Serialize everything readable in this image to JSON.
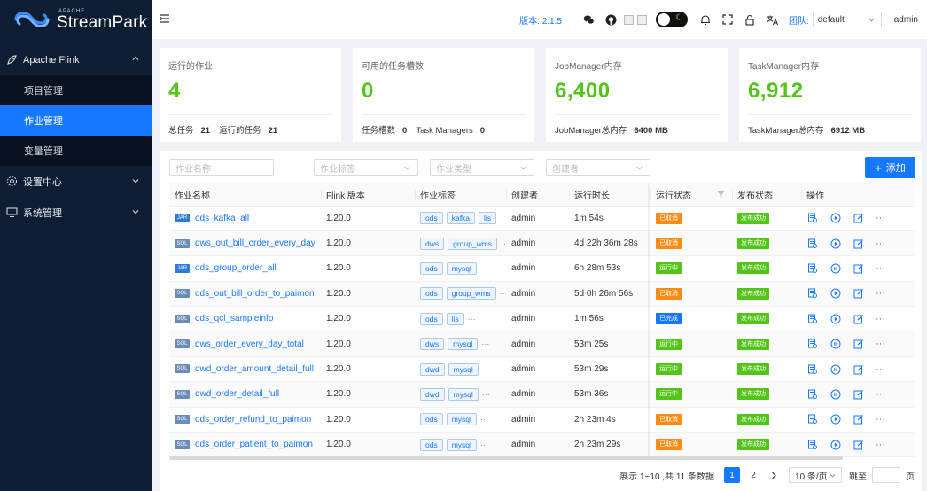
{
  "brand": {
    "apache": "APACHE",
    "name": "StreamPark"
  },
  "sidebar": {
    "groups": [
      {
        "label": "Apache Flink",
        "icon": "flink-icon",
        "expanded": true,
        "items": [
          {
            "label": "项目管理"
          },
          {
            "label": "作业管理",
            "active": true
          },
          {
            "label": "变量管理"
          }
        ]
      },
      {
        "label": "设置中心",
        "icon": "gear-icon",
        "expanded": false
      },
      {
        "label": "系统管理",
        "icon": "monitor-icon",
        "expanded": false
      }
    ]
  },
  "header": {
    "version": "版本: 2.1.5",
    "team_label": "团队:",
    "team_value": "default",
    "username": "admin"
  },
  "cards": [
    {
      "title": "运行的作业",
      "value": "4",
      "foot": [
        {
          "label": "总任务",
          "value": "21"
        },
        {
          "label": "运行的任务",
          "value": "21"
        }
      ]
    },
    {
      "title": "可用的任务槽数",
      "value": "0",
      "foot": [
        {
          "label": "任务槽数",
          "value": "0"
        },
        {
          "label": "Task Managers",
          "value": "0"
        }
      ]
    },
    {
      "title": "JobManager内存",
      "value": "6,400",
      "foot": [
        {
          "label": "JobManager总内存",
          "value": "6400 MB"
        }
      ]
    },
    {
      "title": "TaskManager内存",
      "value": "6,912",
      "foot": [
        {
          "label": "TaskManager总内存",
          "value": "6912 MB"
        }
      ]
    }
  ],
  "filters": {
    "job_name": "作业名称",
    "job_tags": "作业标签",
    "job_type": "作业类型",
    "creator": "创建者",
    "add_button": "添加"
  },
  "table": {
    "headers": {
      "name": "作业名称",
      "flink_version": "Flink 版本",
      "tags": "作业标签",
      "creator": "创建者",
      "duration": "运行时长",
      "run_status": "运行状态",
      "release_status": "发布状态",
      "actions": "操作"
    },
    "rows": [
      {
        "type": "JAR",
        "name": "ods_kafka_all",
        "version": "1.20.0",
        "tags": [
          "ods",
          "kafka",
          "lis"
        ],
        "more": false,
        "creator": "admin",
        "duration": "1m 54s",
        "run_status": "已取消",
        "run_kind": "canceled",
        "release": "发布成功"
      },
      {
        "type": "SQL",
        "name": "dws_out_bill_order_every_day",
        "version": "1.20.0",
        "tags": [
          "dws",
          "group_wms"
        ],
        "more": true,
        "creator": "admin",
        "duration": "4d 22h 36m 28s",
        "run_status": "已取消",
        "run_kind": "canceled",
        "release": "发布成功"
      },
      {
        "type": "JAR",
        "name": "ods_group_order_all",
        "version": "1.20.0",
        "tags": [
          "ods",
          "mysql"
        ],
        "more": true,
        "creator": "admin",
        "duration": "6h 28m 53s",
        "run_status": "运行中",
        "run_kind": "running",
        "release": "发布成功"
      },
      {
        "type": "SQL",
        "name": "ods_out_bill_order_to_paimon",
        "version": "1.20.0",
        "tags": [
          "ods",
          "group_wms"
        ],
        "more": true,
        "creator": "admin",
        "duration": "5d 0h 26m 56s",
        "run_status": "已取消",
        "run_kind": "canceled",
        "release": "发布成功"
      },
      {
        "type": "SQL",
        "name": "ods_qcl_sampleinfo",
        "version": "1.20.0",
        "tags": [
          "ods",
          "lis"
        ],
        "more": true,
        "creator": "admin",
        "duration": "1m 56s",
        "run_status": "已完成",
        "run_kind": "finished",
        "release": "发布成功"
      },
      {
        "type": "SQL",
        "name": "dws_order_every_day_total",
        "version": "1.20.0",
        "tags": [
          "dws",
          "mysql"
        ],
        "more": true,
        "creator": "admin",
        "duration": "53m 25s",
        "run_status": "运行中",
        "run_kind": "running",
        "release": "发布成功"
      },
      {
        "type": "SQL",
        "name": "dwd_order_amount_detail_full",
        "version": "1.20.0",
        "tags": [
          "dwd",
          "mysql"
        ],
        "more": true,
        "creator": "admin",
        "duration": "53m 29s",
        "run_status": "运行中",
        "run_kind": "running",
        "release": "发布成功"
      },
      {
        "type": "SQL",
        "name": "dwd_order_detail_full",
        "version": "1.20.0",
        "tags": [
          "dwd",
          "mysql"
        ],
        "more": true,
        "creator": "admin",
        "duration": "53m 36s",
        "run_status": "运行中",
        "run_kind": "running",
        "release": "发布成功"
      },
      {
        "type": "SQL",
        "name": "ods_order_refund_to_paimon",
        "version": "1.20.0",
        "tags": [
          "ods",
          "mysql"
        ],
        "more": true,
        "creator": "admin",
        "duration": "2h 23m 4s",
        "run_status": "已取消",
        "run_kind": "canceled",
        "release": "发布成功"
      },
      {
        "type": "SQL",
        "name": "ods_order_patient_to_paimon",
        "version": "1.20.0",
        "tags": [
          "ods",
          "mysql"
        ],
        "more": true,
        "creator": "admin",
        "duration": "2h 23m 29s",
        "run_status": "已取消",
        "run_kind": "canceled",
        "release": "发布成功"
      }
    ]
  },
  "pagination": {
    "total_text": "展示 1~10 ,共 11 条数据",
    "pages": [
      "1",
      "2"
    ],
    "current": "1",
    "page_size": "10 条/页",
    "jump_label": "跳至",
    "page_suffix": "页"
  },
  "colors": {
    "accent": "#1677ff",
    "sidebar_bg": "#0f1d32",
    "success": "#52c41a",
    "warning": "#fa8c16"
  }
}
